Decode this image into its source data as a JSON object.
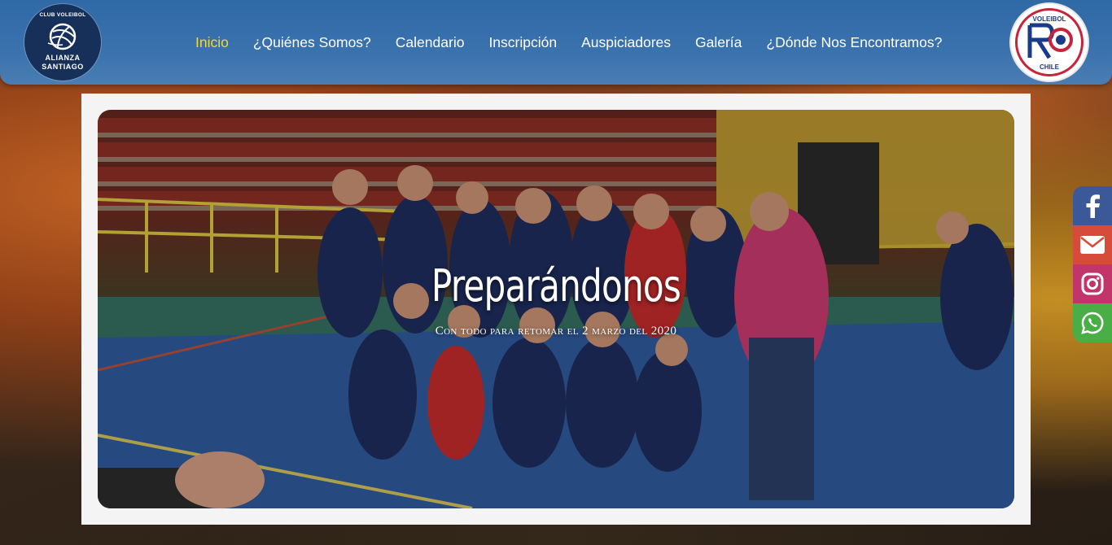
{
  "header": {
    "logo_left": {
      "club": "CLUB VOLEIBOL",
      "name_line1": "ALIANZA",
      "name_line2": "SANTIAGO"
    },
    "nav": [
      {
        "label": "Inicio",
        "active": true
      },
      {
        "label": "¿Quiénes Somos?",
        "active": false
      },
      {
        "label": "Calendario",
        "active": false
      },
      {
        "label": "Inscripción",
        "active": false
      },
      {
        "label": "Auspiciadores",
        "active": false
      },
      {
        "label": "Galería",
        "active": false
      },
      {
        "label": "¿Dónde Nos Encontramos?",
        "active": false
      }
    ],
    "logo_right": {
      "top_text": "VOLEIBOL",
      "bottom_text": "CHILE"
    }
  },
  "hero": {
    "title": "Preparándonos",
    "subtitle": "Con todo para retomar el 2 marzo del 2020"
  },
  "social": [
    {
      "icon": "facebook-icon",
      "color": "#3b5998"
    },
    {
      "icon": "mail-icon",
      "color": "#d64b3a"
    },
    {
      "icon": "instagram-icon",
      "color": "#c2356a"
    },
    {
      "icon": "whatsapp-icon",
      "color": "#4aae46"
    }
  ],
  "colors": {
    "header_bg": "#2f69a6",
    "nav_active": "#f0d93a",
    "nav_text": "#ffffff",
    "panel_bg": "#f4f4f4"
  }
}
